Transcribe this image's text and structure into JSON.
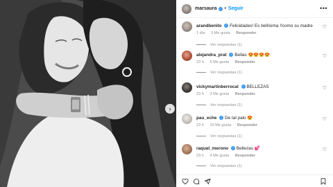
{
  "post": {
    "username": "marsaura",
    "separator": "•",
    "follow_label": "Seguir",
    "more_icon": "more-options-icon",
    "carousel_next_icon": "chevron-right-icon",
    "carousel_next_glyph": "›"
  },
  "comments": [
    {
      "username": "arandbenito",
      "text": "Felicidades! Es bellísima !!como su madre",
      "time": "1 día",
      "likes": "3 Me gusta",
      "reply": "Responder",
      "view_replies": "Ver respuestas (1)",
      "avatar_color": "#9a8f86"
    },
    {
      "username": "alejandra_prat",
      "text": "Bellas 😍😍😍😍",
      "time": "23 h",
      "likes": "5 Me gusta",
      "reply": "Responder",
      "view_replies": "Ver respuestas (1)",
      "avatar_color": "#b4533e"
    },
    {
      "username": "vickymartinberrocal",
      "text": "BELLEZAS",
      "time": "23 h",
      "likes": "3 Me gusta",
      "reply": "Responder",
      "view_replies": "Ver respuestas (1)",
      "avatar_color": "#3f3a36"
    },
    {
      "username": "pau_eche",
      "text": "De tal palo 😍",
      "time": "23 h",
      "likes": "10 Me gusta",
      "reply": "Responder",
      "view_replies": "Ver respuestas (1)",
      "avatar_color": "#c7c1bb"
    },
    {
      "username": "raquel_merono",
      "text": "Bellezas 💕",
      "time": "23 h",
      "likes": "4 Me gusta",
      "reply": "Responder",
      "view_replies": "Ver respuestas (1)",
      "avatar_color": "#a7795d"
    }
  ],
  "actions": {
    "like_icon": "heart-icon",
    "comment_icon": "comment-icon",
    "share_icon": "share-icon",
    "save_icon": "bookmark-icon"
  },
  "colors": {
    "verified_badge": "#3897f0",
    "follow_link": "#0095f6",
    "text": "#262626",
    "secondary_text": "#8e8e8e"
  }
}
